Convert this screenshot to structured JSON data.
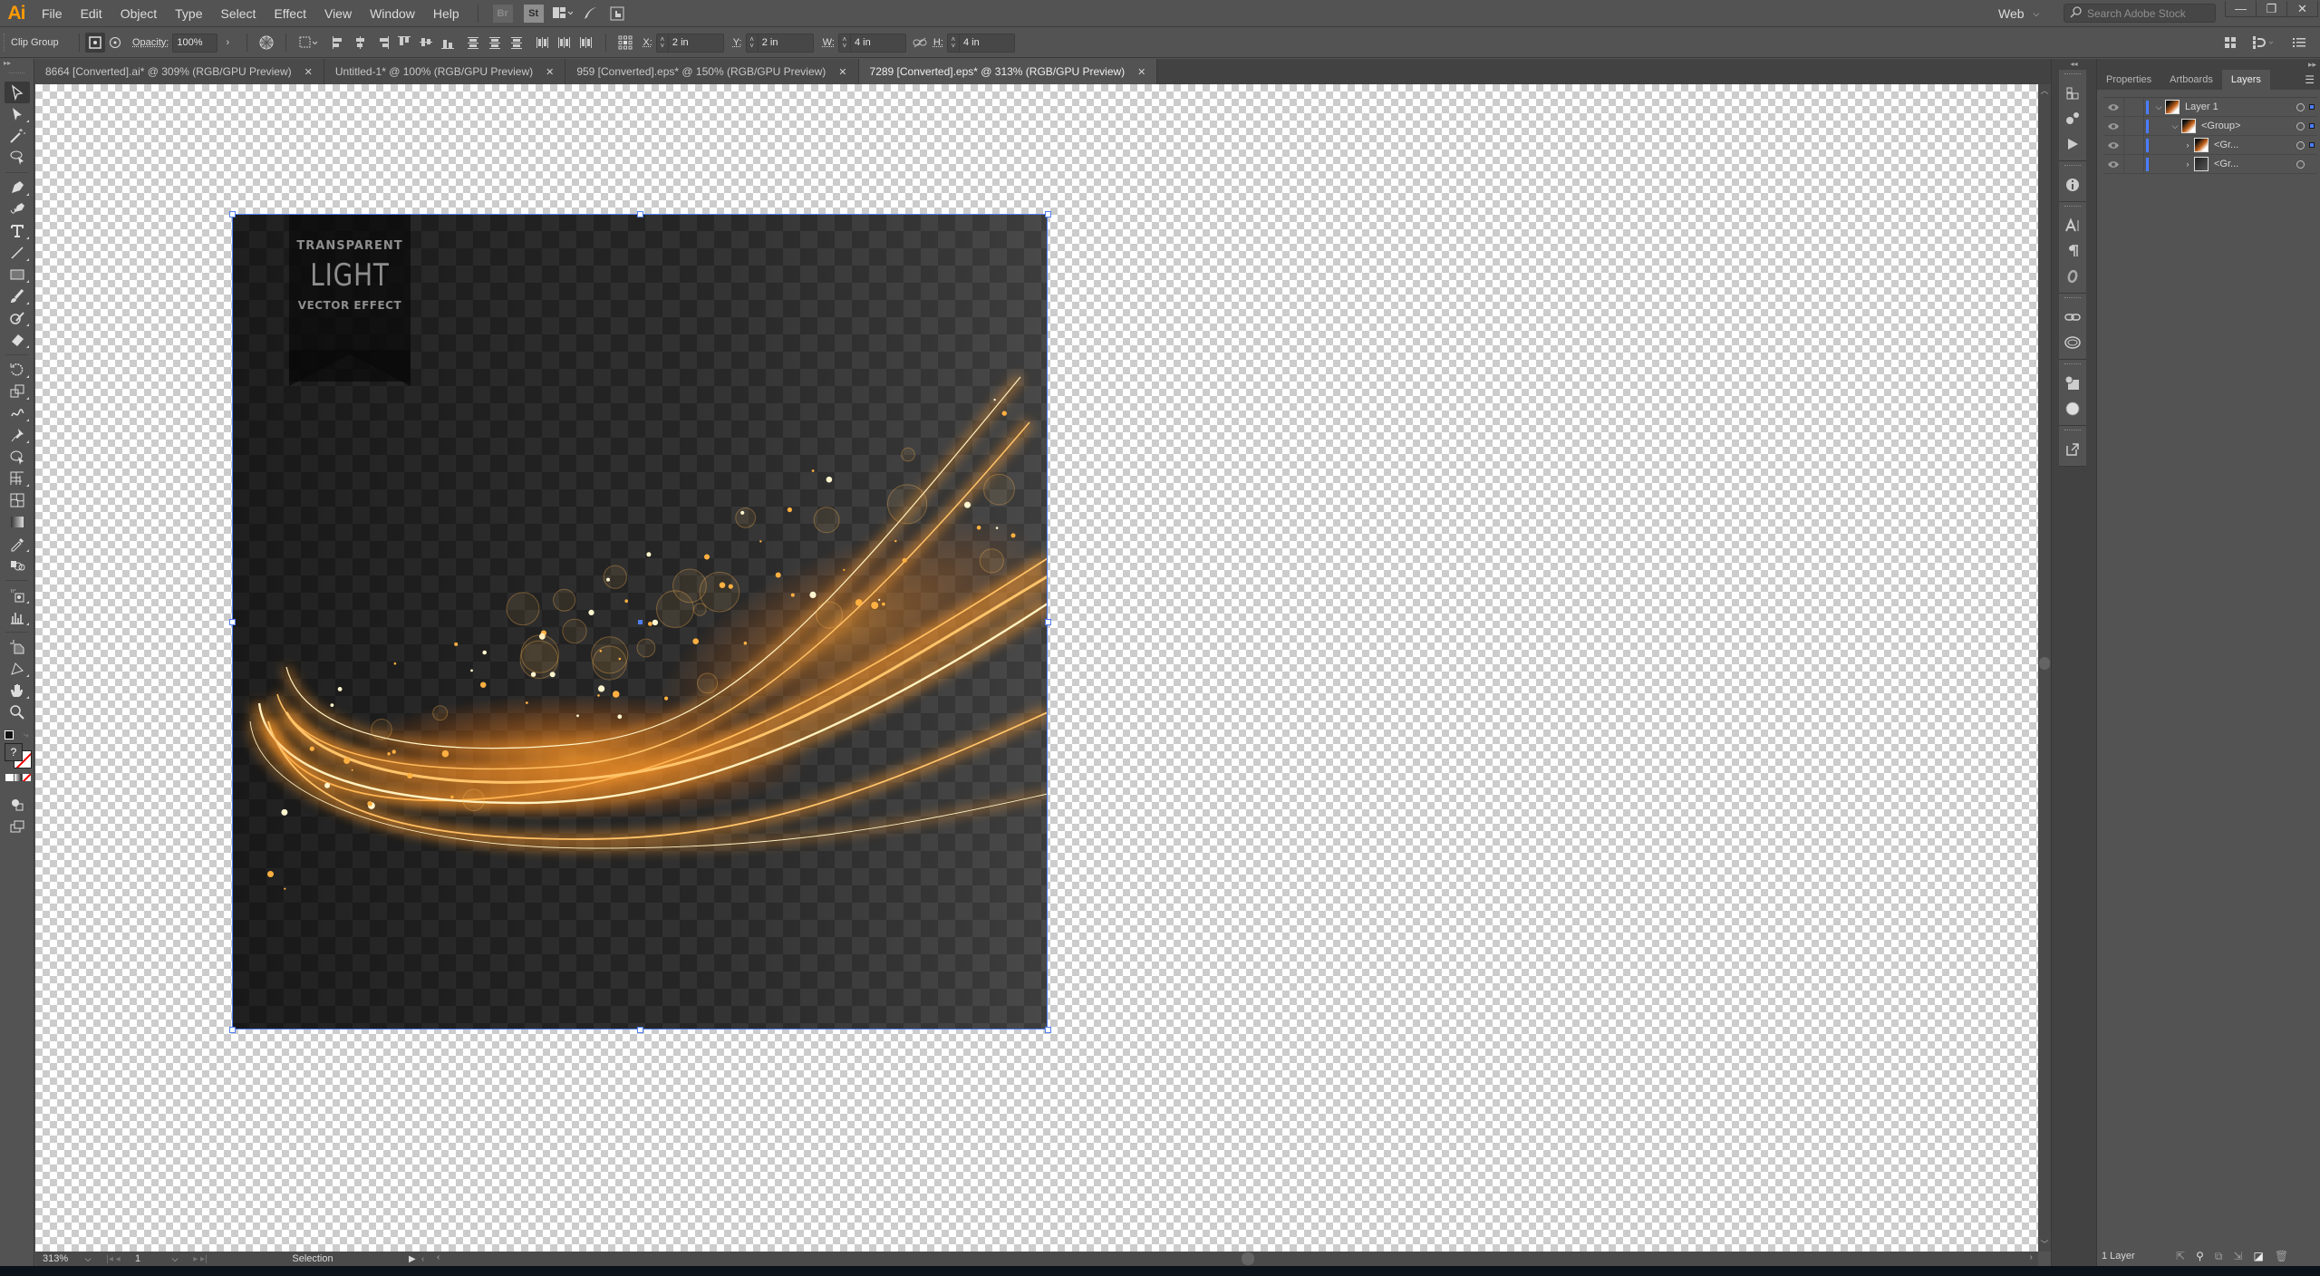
{
  "app": {
    "logo": "Ai",
    "name": "Adobe Illustrator"
  },
  "menu": [
    "File",
    "Edit",
    "Object",
    "Type",
    "Select",
    "Effect",
    "View",
    "Window",
    "Help"
  ],
  "menu_icons": {
    "bridge": "Br",
    "stock": "St"
  },
  "workspace": {
    "label": "Web"
  },
  "stock_search": {
    "placeholder": "Search Adobe Stock",
    "value": ""
  },
  "window_controls": {
    "minimize": "—",
    "restore": "❐",
    "close": "✕"
  },
  "control_bar": {
    "selection_type": "Clip Group",
    "opacity_label": "Opacity:",
    "opacity_value": "100%",
    "x_label": "X:",
    "x_value": "2 in",
    "y_label": "Y:",
    "y_value": "2 in",
    "w_label": "W:",
    "w_value": "4 in",
    "h_label": "H:",
    "h_value": "4 in"
  },
  "tabs": [
    {
      "label": "8664 [Converted].ai* @ 309% (RGB/GPU Preview)",
      "active": false
    },
    {
      "label": "Untitled-1* @ 100% (RGB/GPU Preview)",
      "active": false
    },
    {
      "label": "959 [Converted].eps* @ 150% (RGB/GPU Preview)",
      "active": false
    },
    {
      "label": "7289 [Converted].eps* @ 313% (RGB/GPU Preview)",
      "active": true
    }
  ],
  "tab_close": "✕",
  "artwork": {
    "line1": "TRANSPARENT",
    "line2": "LIGHT",
    "line3": "VECTOR EFFECT",
    "glow_color": "#ff9a2a",
    "core_color": "#fff3c4"
  },
  "status": {
    "zoom": "313%",
    "artboard": "1",
    "tool": "Selection"
  },
  "panel": {
    "tabs": [
      "Properties",
      "Artboards",
      "Layers"
    ],
    "active_tab": "Layers",
    "layers": [
      {
        "name": "Layer 1",
        "depth": 0,
        "expanded": true,
        "selected": true
      },
      {
        "name": "<Group>",
        "depth": 1,
        "expanded": true,
        "selected": true
      },
      {
        "name": "<Gr...",
        "depth": 2,
        "expanded": false,
        "selected": true
      },
      {
        "name": "<Gr...",
        "depth": 2,
        "expanded": false,
        "selected": false
      }
    ],
    "footer_count": "1 Layer"
  },
  "colors": {
    "accent": "#4a7dff",
    "ui_bg": "#535353",
    "logo": "#ff9a00"
  }
}
